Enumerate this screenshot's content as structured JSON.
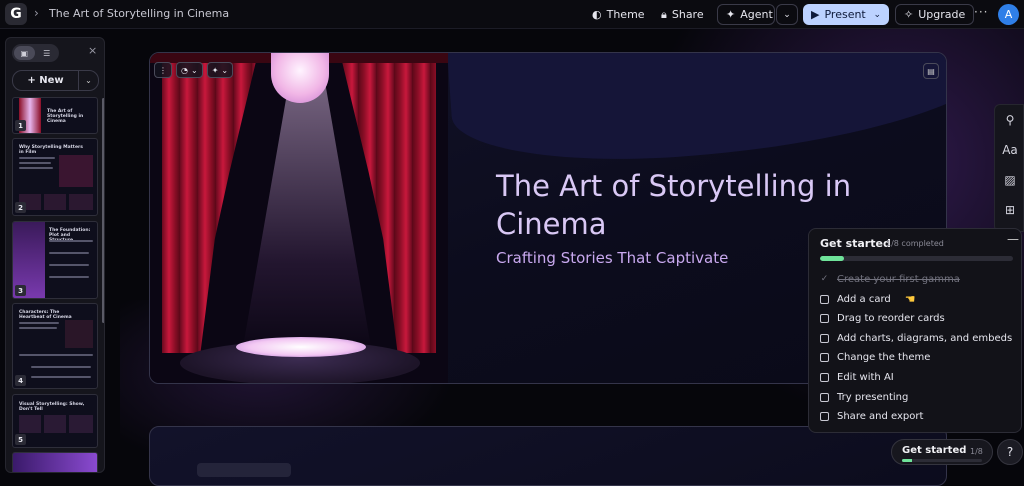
{
  "header": {
    "logo_letter": "G",
    "breadcrumb_sep": "›",
    "title": "The Art of Storytelling in Cinema",
    "theme_label": "Theme",
    "share_label": "Share",
    "agent_label": "Agent",
    "present_label": "Present",
    "upgrade_label": "Upgrade",
    "more_label": "···",
    "avatar_initial": "A"
  },
  "sidebar": {
    "close_label": "×",
    "new_label": "New",
    "thumbnails": [
      {
        "num": "1",
        "title": "The Art of Storytelling in Cinema"
      },
      {
        "num": "2",
        "title": "Why Storytelling Matters in Film"
      },
      {
        "num": "3",
        "title": "The Foundation: Plot and Structure"
      },
      {
        "num": "4",
        "title": "Characters: The Heartbeat of Cinema"
      },
      {
        "num": "5",
        "title": "Visual Storytelling: Show, Don't Tell"
      }
    ]
  },
  "slide": {
    "title": "The Art of Storytelling in Cinema",
    "subtitle": "Crafting Stories That Captivate"
  },
  "get_started": {
    "heading": "Get started",
    "count": "1/8 completed",
    "progress": 0.125,
    "minimize_label": "—",
    "items": [
      {
        "label": "Create your first gamma",
        "done": true
      },
      {
        "label": "Add a card",
        "done": false
      },
      {
        "label": "Drag to reorder cards",
        "done": false
      },
      {
        "label": "Add charts, diagrams, and embeds",
        "done": false
      },
      {
        "label": "Change the theme",
        "done": false
      },
      {
        "label": "Edit with AI",
        "done": false
      },
      {
        "label": "Try presenting",
        "done": false
      },
      {
        "label": "Share and export",
        "done": false
      }
    ],
    "pill_label": "Get started",
    "pill_count": "1/8",
    "help_label": "?"
  },
  "colors": {
    "accent": "#bcd2ff",
    "progress": "#6fe39a",
    "title_text": "#d9c8f5"
  }
}
